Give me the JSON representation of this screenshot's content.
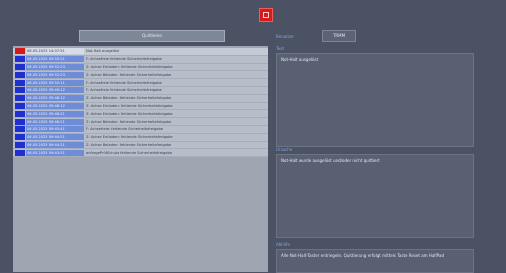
{
  "colors": {
    "alarm_red": "#d41c1c",
    "severity_blue": "#1f2fd0",
    "severity_red": "#d01b1b",
    "timestamp_bg": "#6f8cd8",
    "label_blue": "#7fa6e6",
    "background": "#4b5263"
  },
  "header": {
    "alarm_icon": "alarm-indicator-icon"
  },
  "filter": {
    "button_label": "Quittieren"
  },
  "messages": [
    {
      "severity": "red",
      "timestamp": "06.05.2025 14:07:51",
      "text": "Not-Halt ausgelöst"
    },
    {
      "severity": "blue",
      "timestamp": "06.05.2025 09:55:21",
      "text": "F: Achsefreie fehlende Sicherheitsfreigabe"
    },
    {
      "severity": "blue",
      "timestamp": "06.05.2025 09:52:23",
      "text": "Z: Achse Entladen: fehlende Sicherheitsfreigabe"
    },
    {
      "severity": "blue",
      "timestamp": "06.05.2025 09:52:23",
      "text": "Z: Achse Beladen: fehlende Sicherheitsfreigabe"
    },
    {
      "severity": "blue",
      "timestamp": "06.05.2025 09:50:11",
      "text": "F: Achsefreie fehlende Sicherheitsfreigabe"
    },
    {
      "severity": "blue",
      "timestamp": "06.05.2025 09:49:12",
      "text": "F: Achsefreie fehlende Sicherheitsfreigabe"
    },
    {
      "severity": "blue",
      "timestamp": "06.05.2025 09:48:12",
      "text": "Z: Achse Beladen: fehlende Sicherheitsfreigabe"
    },
    {
      "severity": "blue",
      "timestamp": "06.05.2025 09:48:12",
      "text": "Z: Achse Entladen: fehlende Sicherheitsfreigabe"
    },
    {
      "severity": "blue",
      "timestamp": "06.05.2025 09:46:21",
      "text": "Z: Achse Entladen: fehlende Sicherheitsfreigabe"
    },
    {
      "severity": "blue",
      "timestamp": "06.05.2025 09:46:21",
      "text": "Z: Achse Beladen: fehlende Sicherheitsfreigabe"
    },
    {
      "severity": "blue",
      "timestamp": "06.05.2025 09:45:41",
      "text": "F: Achsefreie: fehlende Sicherheitsfreigabe"
    },
    {
      "severity": "blue",
      "timestamp": "06.05.2025 09:44:51",
      "text": "Z: Achse Entladen: fehlende Sicherheitsfreigabe"
    },
    {
      "severity": "blue",
      "timestamp": "06.05.2025 09:44:21",
      "text": "Z: Achse Beladen: fehlende Sicherheitsfreigabe"
    },
    {
      "severity": "blue",
      "timestamp": "06.05.2025 09:43:51",
      "text": "anfragePrüfSchutz fehlende Sicherheitsfreigabe"
    }
  ],
  "detail": {
    "mode_label": "Benutzer",
    "mode_value": "TRMM",
    "section1_label": "Text",
    "section1_text": "Not-Halt ausgelöst",
    "section2_label": "Ursache",
    "section2_text": "Not-Halt wurde ausgelöst und/oder nicht quittiert",
    "section3_label": "Abhilfe",
    "section3_text": "Alle Not-Halt-Taster entriegeln. Quittierung erfolgt mittels Taste Reset am HalfPad"
  }
}
